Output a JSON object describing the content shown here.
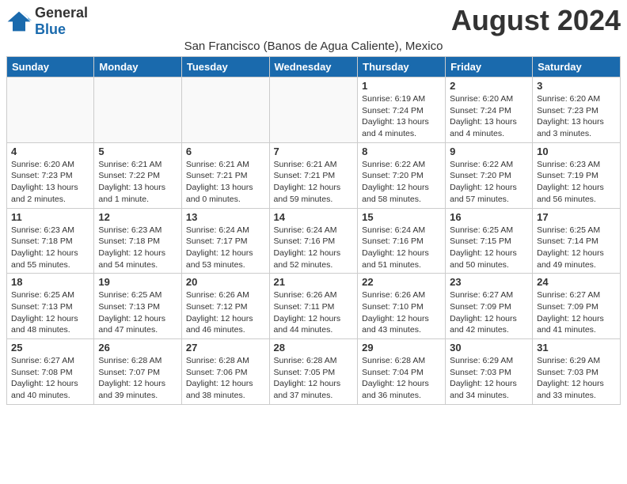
{
  "header": {
    "logo_general": "General",
    "logo_blue": "Blue",
    "month_year": "August 2024",
    "location": "San Francisco (Banos de Agua Caliente), Mexico"
  },
  "calendar": {
    "days_of_week": [
      "Sunday",
      "Monday",
      "Tuesday",
      "Wednesday",
      "Thursday",
      "Friday",
      "Saturday"
    ],
    "weeks": [
      [
        {
          "day": "",
          "info": ""
        },
        {
          "day": "",
          "info": ""
        },
        {
          "day": "",
          "info": ""
        },
        {
          "day": "",
          "info": ""
        },
        {
          "day": "1",
          "info": "Sunrise: 6:19 AM\nSunset: 7:24 PM\nDaylight: 13 hours and 4 minutes."
        },
        {
          "day": "2",
          "info": "Sunrise: 6:20 AM\nSunset: 7:24 PM\nDaylight: 13 hours and 4 minutes."
        },
        {
          "day": "3",
          "info": "Sunrise: 6:20 AM\nSunset: 7:23 PM\nDaylight: 13 hours and 3 minutes."
        }
      ],
      [
        {
          "day": "4",
          "info": "Sunrise: 6:20 AM\nSunset: 7:23 PM\nDaylight: 13 hours and 2 minutes."
        },
        {
          "day": "5",
          "info": "Sunrise: 6:21 AM\nSunset: 7:22 PM\nDaylight: 13 hours and 1 minute."
        },
        {
          "day": "6",
          "info": "Sunrise: 6:21 AM\nSunset: 7:21 PM\nDaylight: 13 hours and 0 minutes."
        },
        {
          "day": "7",
          "info": "Sunrise: 6:21 AM\nSunset: 7:21 PM\nDaylight: 12 hours and 59 minutes."
        },
        {
          "day": "8",
          "info": "Sunrise: 6:22 AM\nSunset: 7:20 PM\nDaylight: 12 hours and 58 minutes."
        },
        {
          "day": "9",
          "info": "Sunrise: 6:22 AM\nSunset: 7:20 PM\nDaylight: 12 hours and 57 minutes."
        },
        {
          "day": "10",
          "info": "Sunrise: 6:23 AM\nSunset: 7:19 PM\nDaylight: 12 hours and 56 minutes."
        }
      ],
      [
        {
          "day": "11",
          "info": "Sunrise: 6:23 AM\nSunset: 7:18 PM\nDaylight: 12 hours and 55 minutes."
        },
        {
          "day": "12",
          "info": "Sunrise: 6:23 AM\nSunset: 7:18 PM\nDaylight: 12 hours and 54 minutes."
        },
        {
          "day": "13",
          "info": "Sunrise: 6:24 AM\nSunset: 7:17 PM\nDaylight: 12 hours and 53 minutes."
        },
        {
          "day": "14",
          "info": "Sunrise: 6:24 AM\nSunset: 7:16 PM\nDaylight: 12 hours and 52 minutes."
        },
        {
          "day": "15",
          "info": "Sunrise: 6:24 AM\nSunset: 7:16 PM\nDaylight: 12 hours and 51 minutes."
        },
        {
          "day": "16",
          "info": "Sunrise: 6:25 AM\nSunset: 7:15 PM\nDaylight: 12 hours and 50 minutes."
        },
        {
          "day": "17",
          "info": "Sunrise: 6:25 AM\nSunset: 7:14 PM\nDaylight: 12 hours and 49 minutes."
        }
      ],
      [
        {
          "day": "18",
          "info": "Sunrise: 6:25 AM\nSunset: 7:13 PM\nDaylight: 12 hours and 48 minutes."
        },
        {
          "day": "19",
          "info": "Sunrise: 6:25 AM\nSunset: 7:13 PM\nDaylight: 12 hours and 47 minutes."
        },
        {
          "day": "20",
          "info": "Sunrise: 6:26 AM\nSunset: 7:12 PM\nDaylight: 12 hours and 46 minutes."
        },
        {
          "day": "21",
          "info": "Sunrise: 6:26 AM\nSunset: 7:11 PM\nDaylight: 12 hours and 44 minutes."
        },
        {
          "day": "22",
          "info": "Sunrise: 6:26 AM\nSunset: 7:10 PM\nDaylight: 12 hours and 43 minutes."
        },
        {
          "day": "23",
          "info": "Sunrise: 6:27 AM\nSunset: 7:09 PM\nDaylight: 12 hours and 42 minutes."
        },
        {
          "day": "24",
          "info": "Sunrise: 6:27 AM\nSunset: 7:09 PM\nDaylight: 12 hours and 41 minutes."
        }
      ],
      [
        {
          "day": "25",
          "info": "Sunrise: 6:27 AM\nSunset: 7:08 PM\nDaylight: 12 hours and 40 minutes."
        },
        {
          "day": "26",
          "info": "Sunrise: 6:28 AM\nSunset: 7:07 PM\nDaylight: 12 hours and 39 minutes."
        },
        {
          "day": "27",
          "info": "Sunrise: 6:28 AM\nSunset: 7:06 PM\nDaylight: 12 hours and 38 minutes."
        },
        {
          "day": "28",
          "info": "Sunrise: 6:28 AM\nSunset: 7:05 PM\nDaylight: 12 hours and 37 minutes."
        },
        {
          "day": "29",
          "info": "Sunrise: 6:28 AM\nSunset: 7:04 PM\nDaylight: 12 hours and 36 minutes."
        },
        {
          "day": "30",
          "info": "Sunrise: 6:29 AM\nSunset: 7:03 PM\nDaylight: 12 hours and 34 minutes."
        },
        {
          "day": "31",
          "info": "Sunrise: 6:29 AM\nSunset: 7:03 PM\nDaylight: 12 hours and 33 minutes."
        }
      ]
    ]
  }
}
